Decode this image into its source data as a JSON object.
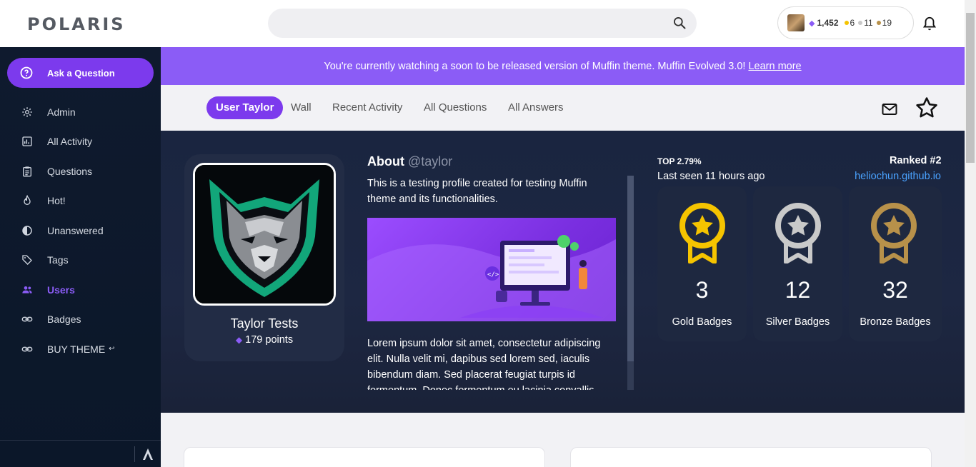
{
  "header": {
    "logo": "POLARIS",
    "search_placeholder": "",
    "user": {
      "reputation": "1,452",
      "gold": "6",
      "silver": "11",
      "bronze": "19"
    }
  },
  "colors": {
    "accent": "#7c3aed",
    "banner": "#8b5cf6",
    "gold": "#f5c400",
    "silver": "#c9c9c9",
    "bronze": "#b8914a",
    "link": "#4aa3ff"
  },
  "sidebar": {
    "ask_label": "Ask a Question",
    "items": [
      {
        "label": "Admin",
        "icon": "gear-icon"
      },
      {
        "label": "All Activity",
        "icon": "activity-icon"
      },
      {
        "label": "Questions",
        "icon": "clipboard-icon"
      },
      {
        "label": "Hot!",
        "icon": "flame-icon"
      },
      {
        "label": "Unanswered",
        "icon": "half-circle-icon"
      },
      {
        "label": "Tags",
        "icon": "tag-icon"
      },
      {
        "label": "Users",
        "icon": "users-icon",
        "active": true
      },
      {
        "label": "Badges",
        "icon": "link-icon"
      },
      {
        "label": "BUY THEME",
        "icon": "link-icon",
        "suffix": "↩"
      }
    ]
  },
  "banner": {
    "text": "You're currently watching a soon to be released version of Muffin theme. Muffin Evolved 3.0!",
    "link": "Learn more"
  },
  "tabs": [
    "User Taylor",
    "Wall",
    "Recent Activity",
    "All Questions",
    "All Answers"
  ],
  "profile": {
    "name": "Taylor Tests",
    "points": "179 points",
    "about_title": "About",
    "handle": "@taylor",
    "about_text": "This is a testing profile created for testing Muffin theme and its functionalities.",
    "lorem": "Lorem ipsum dolor sit amet, consectetur adipiscing elit. Nulla velit mi, dapibus sed lorem sed, iaculis bibendum diam. Sed placerat feugiat turpis id fermentum. Donec fermentum eu lacinia convallis",
    "top_pct": "TOP 2.79%",
    "last_seen": "Last seen 11 hours ago",
    "ranked": "Ranked #2",
    "site": "heliochun.github.io"
  },
  "badges": [
    {
      "count": "3",
      "label": "Gold Badges",
      "color": "#f5c400"
    },
    {
      "count": "12",
      "label": "Silver Badges",
      "color": "#c9c9c9"
    },
    {
      "count": "32",
      "label": "Bronze Badges",
      "color": "#b8914a"
    }
  ]
}
